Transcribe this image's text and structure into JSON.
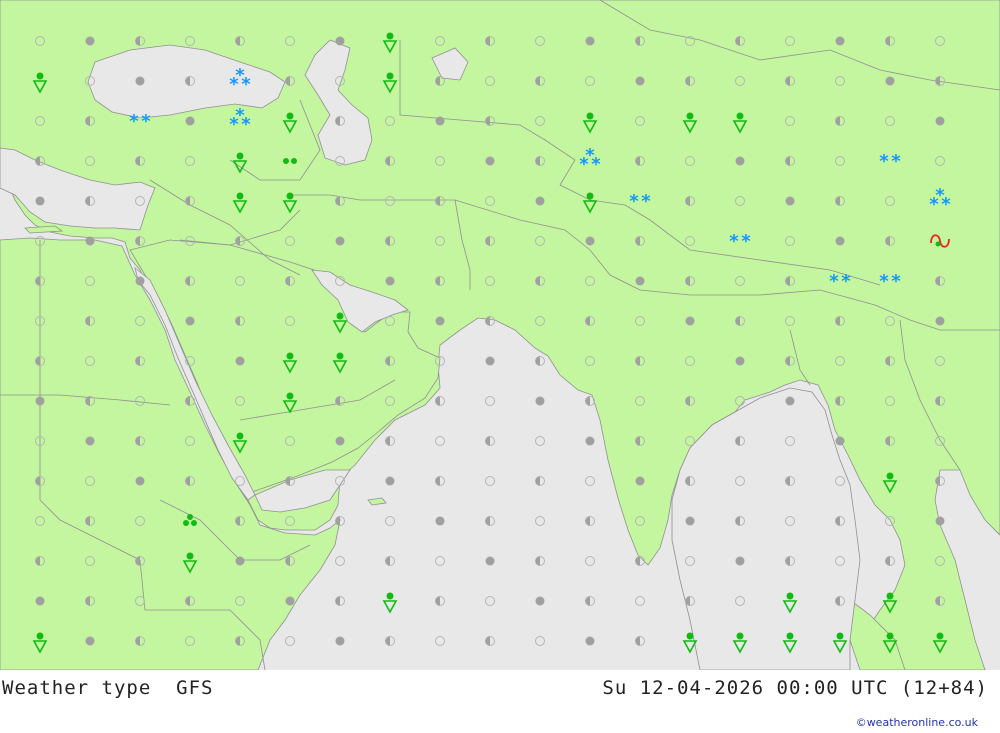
{
  "title_left": "Weather type  GFS",
  "title_right": "Su 12-04-2026 00:00 UTC (12+84)",
  "credit": "©weatheronline.co.uk",
  "colors": {
    "land": "#c4f6a0",
    "sea": "#e8e8e8",
    "border": "#909090",
    "dot_fill": "#a0a0a0",
    "dot_outline": "#b4b4b4",
    "rain": "#11bb11",
    "snow": "#1199ff",
    "thunder": "#ee2222"
  },
  "symbols": [
    {
      "type": "shower",
      "col": 7,
      "row": 0
    },
    {
      "type": "shower",
      "col": 0,
      "row": 1
    },
    {
      "type": "snow",
      "col": 4,
      "row": 1
    },
    {
      "type": "shower",
      "col": 7,
      "row": 1
    },
    {
      "type": "snow2",
      "col": 2,
      "row": 2
    },
    {
      "type": "snow",
      "col": 4,
      "row": 2
    },
    {
      "type": "shower",
      "col": 5,
      "row": 2
    },
    {
      "type": "shower",
      "col": 11,
      "row": 2
    },
    {
      "type": "shower",
      "col": 13,
      "row": 2
    },
    {
      "type": "shower",
      "col": 14,
      "row": 2
    },
    {
      "type": "shower",
      "col": 4,
      "row": 3
    },
    {
      "type": "rain2",
      "col": 5,
      "row": 3
    },
    {
      "type": "snow",
      "col": 11,
      "row": 3
    },
    {
      "type": "snow2",
      "col": 17,
      "row": 3
    },
    {
      "type": "shower",
      "col": 4,
      "row": 4
    },
    {
      "type": "shower",
      "col": 5,
      "row": 4
    },
    {
      "type": "shower",
      "col": 11,
      "row": 4
    },
    {
      "type": "snow2",
      "col": 12,
      "row": 4
    },
    {
      "type": "snow",
      "col": 18,
      "row": 4
    },
    {
      "type": "snow2",
      "col": 14,
      "row": 5
    },
    {
      "type": "thunder",
      "col": 18,
      "row": 5
    },
    {
      "type": "snow2",
      "col": 16,
      "row": 6
    },
    {
      "type": "snow2",
      "col": 17,
      "row": 6
    },
    {
      "type": "shower",
      "col": 6,
      "row": 7
    },
    {
      "type": "shower",
      "col": 5,
      "row": 8
    },
    {
      "type": "shower",
      "col": 6,
      "row": 8
    },
    {
      "type": "shower",
      "col": 5,
      "row": 9
    },
    {
      "type": "shower",
      "col": 4,
      "row": 10
    },
    {
      "type": "shower",
      "col": 17,
      "row": 11
    },
    {
      "type": "rain3",
      "col": 3,
      "row": 12
    },
    {
      "type": "shower",
      "col": 3,
      "row": 13
    },
    {
      "type": "shower",
      "col": 7,
      "row": 14
    },
    {
      "type": "shower",
      "col": 15,
      "row": 14
    },
    {
      "type": "shower",
      "col": 17,
      "row": 14
    },
    {
      "type": "shower",
      "col": 0,
      "row": 15
    },
    {
      "type": "shower",
      "col": 13,
      "row": 15
    },
    {
      "type": "shower",
      "col": 14,
      "row": 15
    },
    {
      "type": "shower",
      "col": 15,
      "row": 15
    },
    {
      "type": "shower",
      "col": 16,
      "row": 15
    },
    {
      "type": "shower",
      "col": 17,
      "row": 15
    },
    {
      "type": "shower",
      "col": 18,
      "row": 15
    }
  ]
}
